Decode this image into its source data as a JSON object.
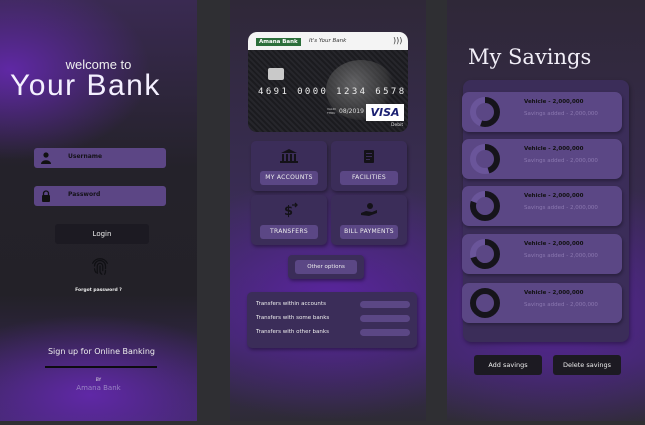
{
  "login": {
    "welcome": "welcome to",
    "title": "Your Bank",
    "username_label": "Username",
    "password_label": "Password",
    "login_label": "Login",
    "forgot": "Forgot password ?",
    "signup": "Sign up for Online Banking",
    "by": "BY",
    "brand": "Amana Bank"
  },
  "dashboard": {
    "card": {
      "bank": "Amana Bank",
      "tagline": "It's Your Bank",
      "number": "4691 0000 1234 6578",
      "valid_label": "VALID THRU",
      "expiry": "08/2019",
      "network": "VISA",
      "type": "Debit"
    },
    "tiles": [
      {
        "label": "MY ACCOUNTS",
        "icon": "bank-icon"
      },
      {
        "label": "FACILITIES",
        "icon": "document-icon"
      },
      {
        "label": "TRANSFERS",
        "icon": "money-transfer-icon"
      },
      {
        "label": "BILL PAYMENTS",
        "icon": "hand-coin-icon"
      }
    ],
    "other_options": "Other options",
    "transfers": [
      "Transfers within  accounts",
      "Transfers with some banks",
      "Transfers with other banks"
    ]
  },
  "savings": {
    "title": "My Savings",
    "items": [
      {
        "name": "Vehicle - 2,000,000",
        "added": "Savings added - 2,000,000",
        "progress": 0.55
      },
      {
        "name": "Vehicle - 2,000,000",
        "added": "Savings added - 2,000,000",
        "progress": 0.45
      },
      {
        "name": "Vehicle - 2,000,000",
        "added": "Savings added - 2,000,000",
        "progress": 0.8
      },
      {
        "name": "Vehicle - 2,000,000",
        "added": "Savings added - 2,000,000",
        "progress": 0.7
      },
      {
        "name": "Vehicle - 2,000,000",
        "added": "Savings added - 2,000,000",
        "progress": 1.0
      }
    ],
    "add_label": "Add savings",
    "delete_label": "Delete savings"
  },
  "colors": {
    "accent": "#5b4785",
    "dark_button": "#1c1a22",
    "brand_purple": "#6a2fb0"
  }
}
